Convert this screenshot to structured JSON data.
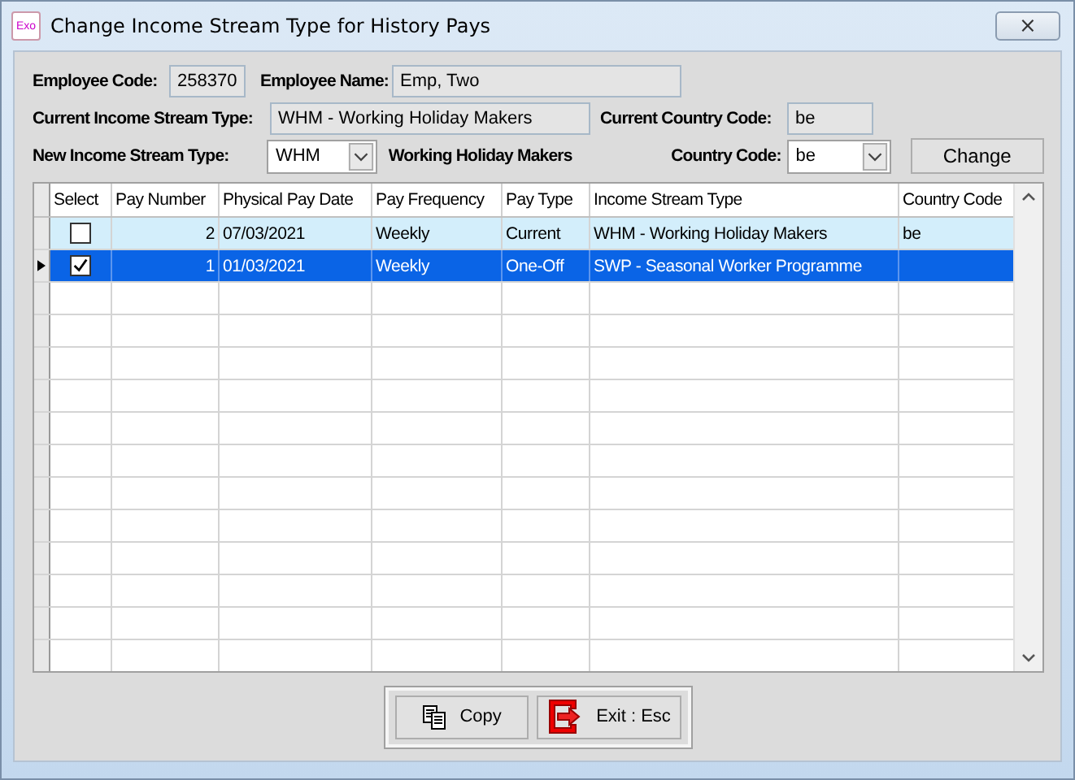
{
  "window": {
    "icon_text": "Exo",
    "title": "Change Income Stream Type for History Pays",
    "close": "⨯"
  },
  "form": {
    "employee_code_label": "Employee Code:",
    "employee_code": "258370",
    "employee_name_label": "Employee Name:",
    "employee_name": "Emp, Two",
    "current_type_label": "Current Income Stream Type:",
    "current_type": "WHM - Working Holiday Makers",
    "current_country_label": "Current Country Code:",
    "current_country": "be",
    "new_type_label": "New Income Stream Type:",
    "new_type": "WHM",
    "new_type_desc": "Working Holiday Makers",
    "country_label": "Country Code:",
    "country": "be",
    "change_button": "Change"
  },
  "table": {
    "columns": [
      "Select",
      "Pay Number",
      "Physical Pay Date",
      "Pay Frequency",
      "Pay Type",
      "Income Stream Type",
      "Country Code"
    ],
    "rows": [
      {
        "checked": false,
        "selected": false,
        "cells": [
          "",
          "2",
          "07/03/2021",
          "Weekly",
          "Current",
          "WHM - Working Holiday Makers",
          "be"
        ]
      },
      {
        "checked": true,
        "selected": true,
        "cells": [
          "",
          "1",
          "01/03/2021",
          "Weekly",
          "One-Off",
          "SWP - Seasonal Worker Programme",
          ""
        ]
      }
    ]
  },
  "buttons": [
    {
      "kind": "copy",
      "label": "Copy"
    },
    {
      "kind": "exit",
      "label": "Exit : Esc"
    }
  ]
}
